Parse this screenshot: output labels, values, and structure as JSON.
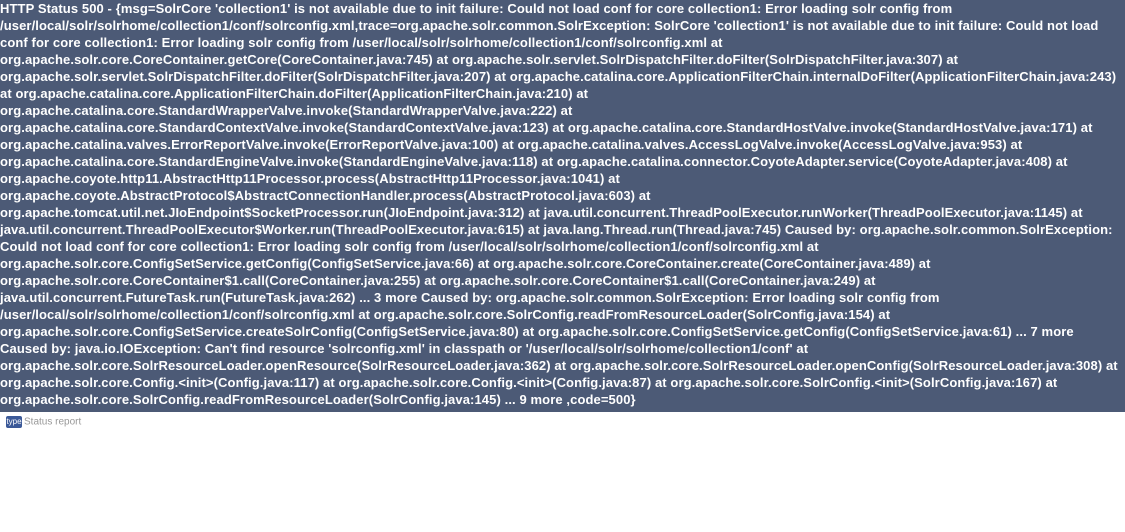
{
  "error": {
    "stacktrace": "HTTP Status 500 - {msg=SolrCore 'collection1' is not available due to init failure: Could not load conf for core collection1: Error loading solr config from /user/local/solr/solrhome/collection1/conf/solrconfig.xml,trace=org.apache.solr.common.SolrException: SolrCore 'collection1' is not available due to init failure: Could not load conf for core collection1: Error loading solr config from /user/local/solr/solrhome/collection1/conf/solrconfig.xml at org.apache.solr.core.CoreContainer.getCore(CoreContainer.java:745) at org.apache.solr.servlet.SolrDispatchFilter.doFilter(SolrDispatchFilter.java:307) at org.apache.solr.servlet.SolrDispatchFilter.doFilter(SolrDispatchFilter.java:207) at org.apache.catalina.core.ApplicationFilterChain.internalDoFilter(ApplicationFilterChain.java:243) at org.apache.catalina.core.ApplicationFilterChain.doFilter(ApplicationFilterChain.java:210) at org.apache.catalina.core.StandardWrapperValve.invoke(StandardWrapperValve.java:222) at org.apache.catalina.core.StandardContextValve.invoke(StandardContextValve.java:123) at org.apache.catalina.core.StandardHostValve.invoke(StandardHostValve.java:171) at org.apache.catalina.valves.ErrorReportValve.invoke(ErrorReportValve.java:100) at org.apache.catalina.valves.AccessLogValve.invoke(AccessLogValve.java:953) at org.apache.catalina.core.StandardEngineValve.invoke(StandardEngineValve.java:118) at org.apache.catalina.connector.CoyoteAdapter.service(CoyoteAdapter.java:408) at org.apache.coyote.http11.AbstractHttp11Processor.process(AbstractHttp11Processor.java:1041) at org.apache.coyote.AbstractProtocol$AbstractConnectionHandler.process(AbstractProtocol.java:603) at org.apache.tomcat.util.net.JIoEndpoint$SocketProcessor.run(JIoEndpoint.java:312) at java.util.concurrent.ThreadPoolExecutor.runWorker(ThreadPoolExecutor.java:1145) at java.util.concurrent.ThreadPoolExecutor$Worker.run(ThreadPoolExecutor.java:615) at java.lang.Thread.run(Thread.java:745) Caused by: org.apache.solr.common.SolrException: Could not load conf for core collection1: Error loading solr config from /user/local/solr/solrhome/collection1/conf/solrconfig.xml at org.apache.solr.core.ConfigSetService.getConfig(ConfigSetService.java:66) at org.apache.solr.core.CoreContainer.create(CoreContainer.java:489) at org.apache.solr.core.CoreContainer$1.call(CoreContainer.java:255) at org.apache.solr.core.CoreContainer$1.call(CoreContainer.java:249) at java.util.concurrent.FutureTask.run(FutureTask.java:262) ... 3 more Caused by: org.apache.solr.common.SolrException: Error loading solr config from /user/local/solr/solrhome/collection1/conf/solrconfig.xml at org.apache.solr.core.SolrConfig.readFromResourceLoader(SolrConfig.java:154) at org.apache.solr.core.ConfigSetService.createSolrConfig(ConfigSetService.java:80) at org.apache.solr.core.ConfigSetService.getConfig(ConfigSetService.java:61) ... 7 more Caused by: java.io.IOException: Can't find resource 'solrconfig.xml' in classpath or '/user/local/solr/solrhome/collection1/conf' at org.apache.solr.core.SolrResourceLoader.openResource(SolrResourceLoader.java:362) at org.apache.solr.core.SolrResourceLoader.openConfig(SolrResourceLoader.java:308) at org.apache.solr.core.Config.<init>(Config.java:117) at org.apache.solr.core.Config.<init>(Config.java:87) at org.apache.solr.core.SolrConfig.<init>(SolrConfig.java:167) at org.apache.solr.core.SolrConfig.readFromResourceLoader(SolrConfig.java:145) ... 9 more ,code=500}"
  },
  "status_report": {
    "marker": "type",
    "label": "Status report"
  }
}
